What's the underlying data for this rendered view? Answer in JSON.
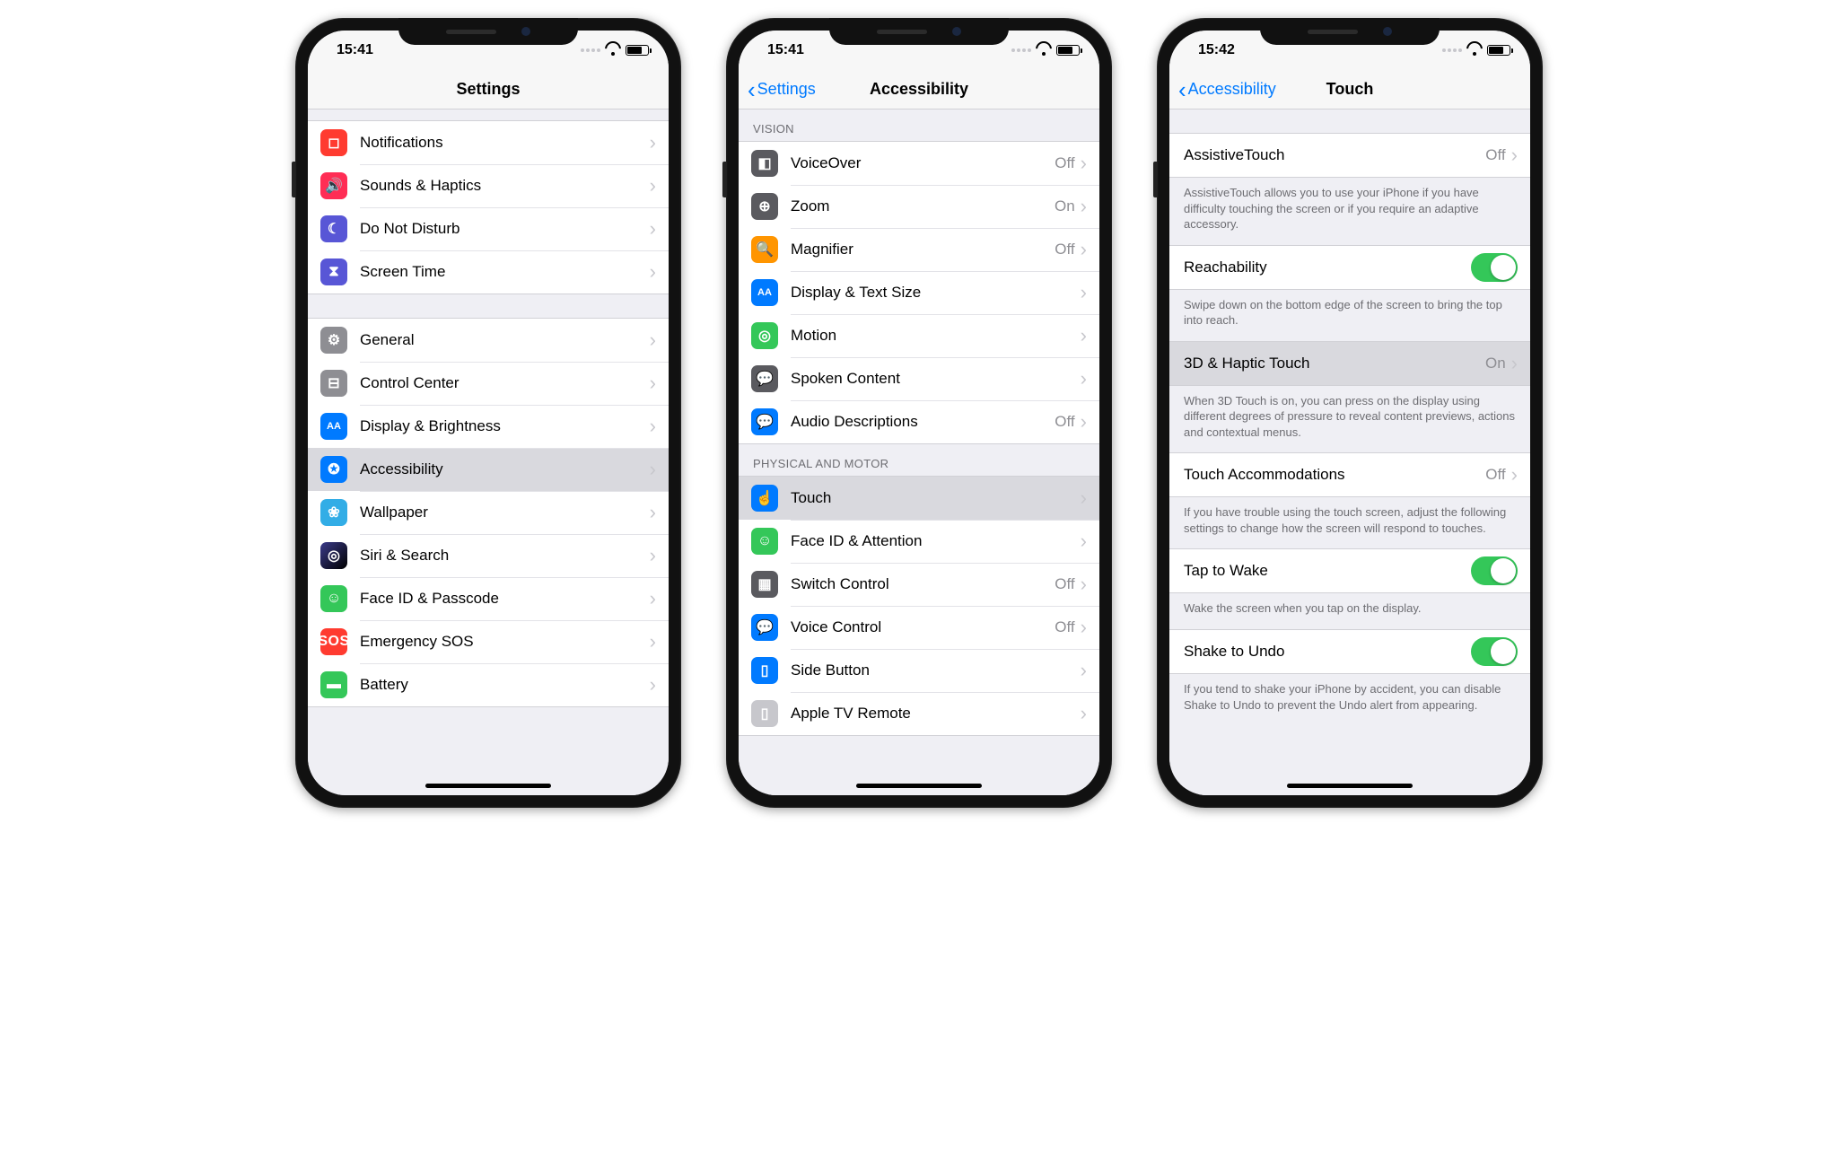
{
  "phone1": {
    "time": "15:41",
    "title": "Settings",
    "group1": [
      {
        "label": "Notifications",
        "icon": "notifications-icon",
        "bg": "bg-red",
        "glyph": "◻"
      },
      {
        "label": "Sounds & Haptics",
        "icon": "sounds-icon",
        "bg": "bg-pink",
        "glyph": "🔊"
      },
      {
        "label": "Do Not Disturb",
        "icon": "dnd-icon",
        "bg": "bg-purple",
        "glyph": "☾"
      },
      {
        "label": "Screen Time",
        "icon": "screentime-icon",
        "bg": "bg-purple",
        "glyph": "⧗"
      }
    ],
    "group2": [
      {
        "label": "General",
        "icon": "general-icon",
        "bg": "bg-gray",
        "glyph": "⚙"
      },
      {
        "label": "Control Center",
        "icon": "controlcenter-icon",
        "bg": "bg-gray",
        "glyph": "⊟"
      },
      {
        "label": "Display & Brightness",
        "icon": "display-icon",
        "bg": "bg-blue",
        "glyph": "AA"
      },
      {
        "label": "Accessibility",
        "icon": "accessibility-icon",
        "bg": "bg-blue",
        "glyph": "✪",
        "selected": true
      },
      {
        "label": "Wallpaper",
        "icon": "wallpaper-icon",
        "bg": "bg-cyan",
        "glyph": "❀"
      },
      {
        "label": "Siri & Search",
        "icon": "siri-icon",
        "bg": "bg-siri",
        "glyph": "◎"
      },
      {
        "label": "Face ID & Passcode",
        "icon": "faceid-icon",
        "bg": "bg-green",
        "glyph": "☺"
      },
      {
        "label": "Emergency SOS",
        "icon": "sos-icon",
        "bg": "bg-sos",
        "glyph": "SOS"
      },
      {
        "label": "Battery",
        "icon": "battery-icon",
        "bg": "bg-green",
        "glyph": "▬"
      }
    ]
  },
  "phone2": {
    "time": "15:41",
    "back": "Settings",
    "title": "Accessibility",
    "section_vision": "Vision",
    "vision": [
      {
        "label": "VoiceOver",
        "value": "Off",
        "icon": "voiceover-icon",
        "bg": "bg-darkgray",
        "glyph": "◧"
      },
      {
        "label": "Zoom",
        "value": "On",
        "icon": "zoom-icon",
        "bg": "bg-darkgray",
        "glyph": "⊕"
      },
      {
        "label": "Magnifier",
        "value": "Off",
        "icon": "magnifier-icon",
        "bg": "bg-orange",
        "glyph": "🔍"
      },
      {
        "label": "Display & Text Size",
        "value": "",
        "icon": "textsize-icon",
        "bg": "bg-blue",
        "glyph": "AA"
      },
      {
        "label": "Motion",
        "value": "",
        "icon": "motion-icon",
        "bg": "bg-green",
        "glyph": "◎"
      },
      {
        "label": "Spoken Content",
        "value": "",
        "icon": "spoken-icon",
        "bg": "bg-darkgray",
        "glyph": "💬"
      },
      {
        "label": "Audio Descriptions",
        "value": "Off",
        "icon": "audiodesc-icon",
        "bg": "bg-blue",
        "glyph": "💬"
      }
    ],
    "section_motor": "Physical and Motor",
    "motor": [
      {
        "label": "Touch",
        "value": "",
        "icon": "touch-icon",
        "bg": "bg-blue",
        "glyph": "☝",
        "selected": true
      },
      {
        "label": "Face ID & Attention",
        "value": "",
        "icon": "faceid-att-icon",
        "bg": "bg-green",
        "glyph": "☺"
      },
      {
        "label": "Switch Control",
        "value": "Off",
        "icon": "switch-icon",
        "bg": "bg-darkgray",
        "glyph": "▦"
      },
      {
        "label": "Voice Control",
        "value": "Off",
        "icon": "voicecontrol-icon",
        "bg": "bg-blue",
        "glyph": "💬"
      },
      {
        "label": "Side Button",
        "value": "",
        "icon": "sidebutton-icon",
        "bg": "bg-blue",
        "glyph": "▯"
      },
      {
        "label": "Apple TV Remote",
        "value": "",
        "icon": "appletv-icon",
        "bg": "bg-lightgray",
        "glyph": "▯"
      }
    ]
  },
  "phone3": {
    "time": "15:42",
    "back": "Accessibility",
    "title": "Touch",
    "rows": [
      {
        "type": "link",
        "label": "AssistiveTouch",
        "value": "Off"
      },
      {
        "type": "note",
        "text": "AssistiveTouch allows you to use your iPhone if you have difficulty touching the screen or if you require an adaptive accessory."
      },
      {
        "type": "toggle",
        "label": "Reachability",
        "on": true
      },
      {
        "type": "note",
        "text": "Swipe down on the bottom edge of the screen to bring the top into reach."
      },
      {
        "type": "link",
        "label": "3D & Haptic Touch",
        "value": "On",
        "selected": true
      },
      {
        "type": "note",
        "text": "When 3D Touch is on, you can press on the display using different degrees of pressure to reveal content previews, actions and contextual menus."
      },
      {
        "type": "link",
        "label": "Touch Accommodations",
        "value": "Off"
      },
      {
        "type": "note",
        "text": "If you have trouble using the touch screen, adjust the following settings to change how the screen will respond to touches."
      },
      {
        "type": "toggle",
        "label": "Tap to Wake",
        "on": true
      },
      {
        "type": "note",
        "text": "Wake the screen when you tap on the display."
      },
      {
        "type": "toggle",
        "label": "Shake to Undo",
        "on": true
      },
      {
        "type": "note",
        "text": "If you tend to shake your iPhone by accident, you can disable Shake to Undo to prevent the Undo alert from appearing."
      }
    ]
  }
}
